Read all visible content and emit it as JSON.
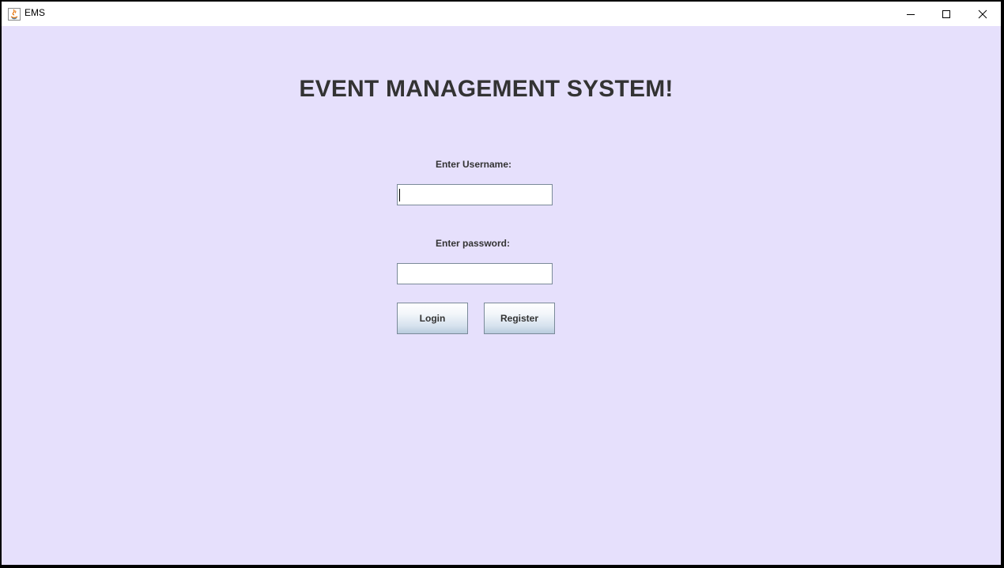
{
  "window": {
    "title": "EMS",
    "controls": {
      "minimize": "minimize-icon",
      "maximize": "maximize-icon",
      "close": "close-icon"
    }
  },
  "form": {
    "heading": "EVENT MANAGEMENT SYSTEM!",
    "username_label": "Enter Username:",
    "username_value": "",
    "password_label": "Enter password:",
    "password_value": "",
    "login_label": "Login",
    "register_label": "Register"
  },
  "colors": {
    "background": "#e6e0fc",
    "heading_text": "#333333",
    "button_gradient_bottom": "#b8cbdd"
  }
}
